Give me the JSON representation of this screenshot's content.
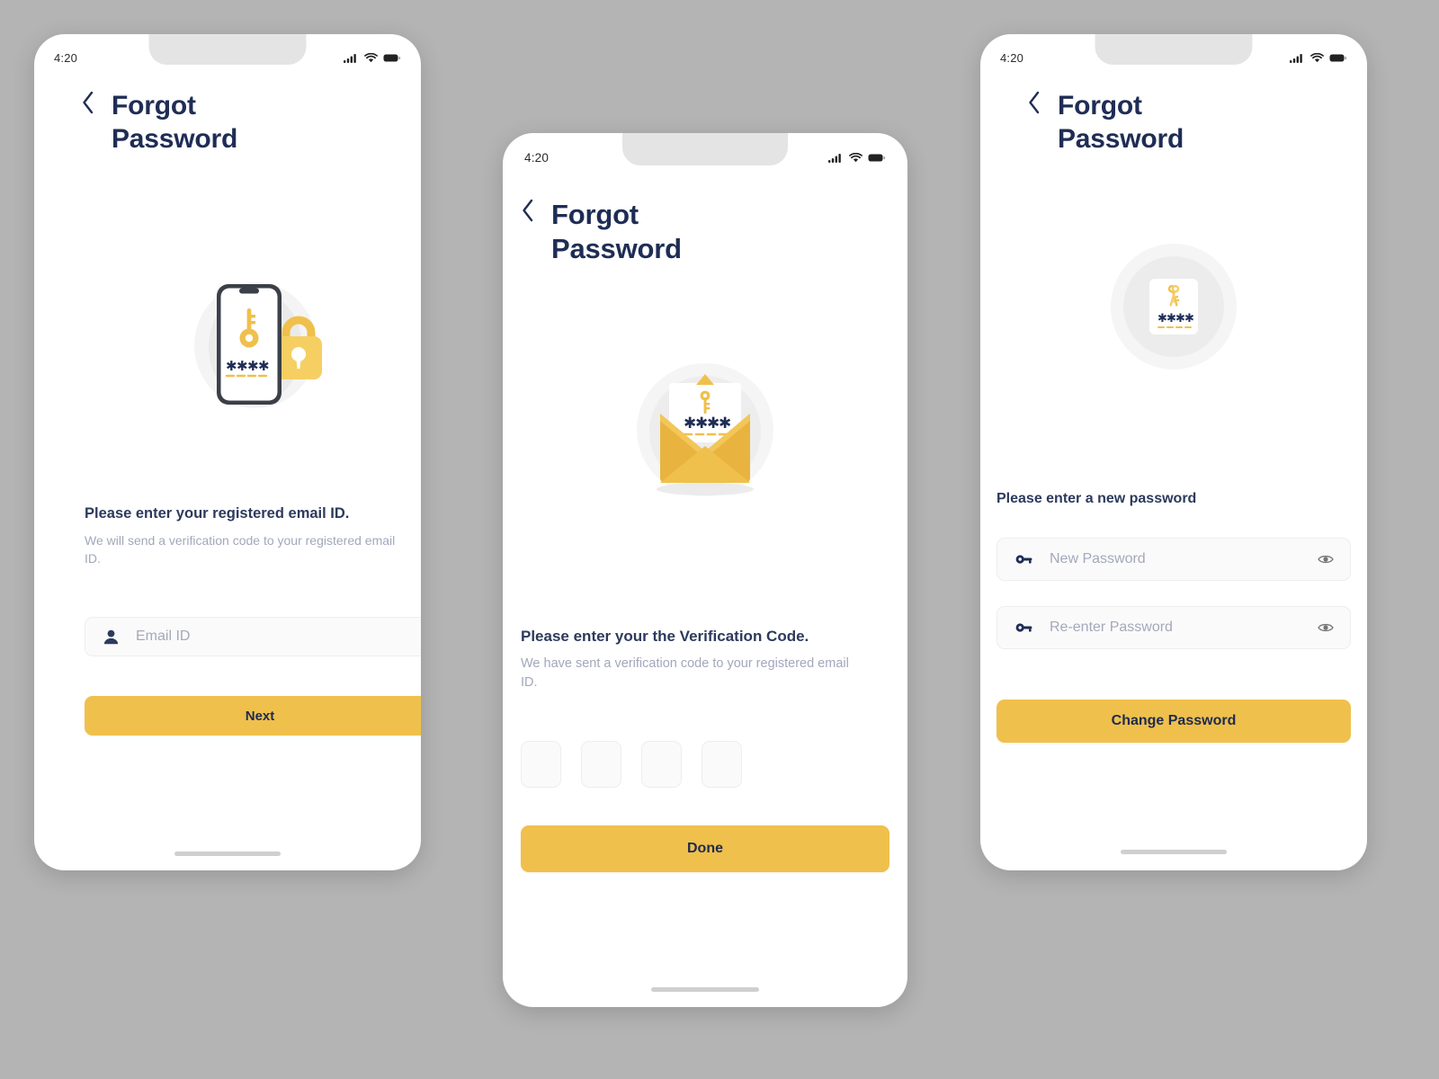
{
  "background_color": "#b4b4b4",
  "theme": {
    "accent_yellow": "#f0c04c",
    "title_navy": "#1f2d55",
    "body_text": "#2c3a5c",
    "muted_text": "#a2a8bb",
    "field_bg": "#fafafa",
    "field_border": "#eceef1"
  },
  "screens": [
    {
      "id": "screen-email",
      "status": {
        "time": "4:20",
        "signal": "signal-icon",
        "wifi": "wifi-icon",
        "battery": "battery-icon"
      },
      "header": {
        "back": "chevron-left-icon",
        "title": "Forgot\nPassword"
      },
      "illustration": "phone-key-lock-illustration",
      "prompt": {
        "title": "Please enter your registered email ID.",
        "subtitle": "We will send a verification code to your registered email ID."
      },
      "field": {
        "icon": "person-icon",
        "placeholder": "Email ID",
        "value": ""
      },
      "button": {
        "label": "Next"
      },
      "home_indicator": true
    },
    {
      "id": "screen-verification",
      "status": {
        "time": "4:20",
        "signal": "signal-icon",
        "wifi": "wifi-icon",
        "battery": "battery-icon"
      },
      "header": {
        "back": "chevron-left-icon",
        "title": "Forgot\nPassword"
      },
      "illustration": "envelope-key-illustration",
      "prompt": {
        "title": "Please enter your the Verification Code.",
        "subtitle": "We have sent a verification code to your registered email ID."
      },
      "otp": {
        "length": 4,
        "values": [
          "",
          "",
          "",
          ""
        ]
      },
      "button": {
        "label": "Done"
      },
      "home_indicator": true
    },
    {
      "id": "screen-new-password",
      "status": {
        "time": "4:20",
        "signal": "signal-icon",
        "wifi": "wifi-icon",
        "battery": "battery-icon"
      },
      "header": {
        "back": "chevron-left-icon",
        "title": "Forgot\nPassword"
      },
      "illustration": "card-keys-illustration",
      "prompt": {
        "title": "Please enter a new password"
      },
      "fields": [
        {
          "icon": "key-icon",
          "placeholder": "New Password",
          "value": "",
          "toggle": "eye-icon"
        },
        {
          "icon": "key-icon",
          "placeholder": "Re-enter Password",
          "value": "",
          "toggle": "eye-icon"
        }
      ],
      "button": {
        "label": "Change Password"
      },
      "home_indicator": true
    }
  ]
}
